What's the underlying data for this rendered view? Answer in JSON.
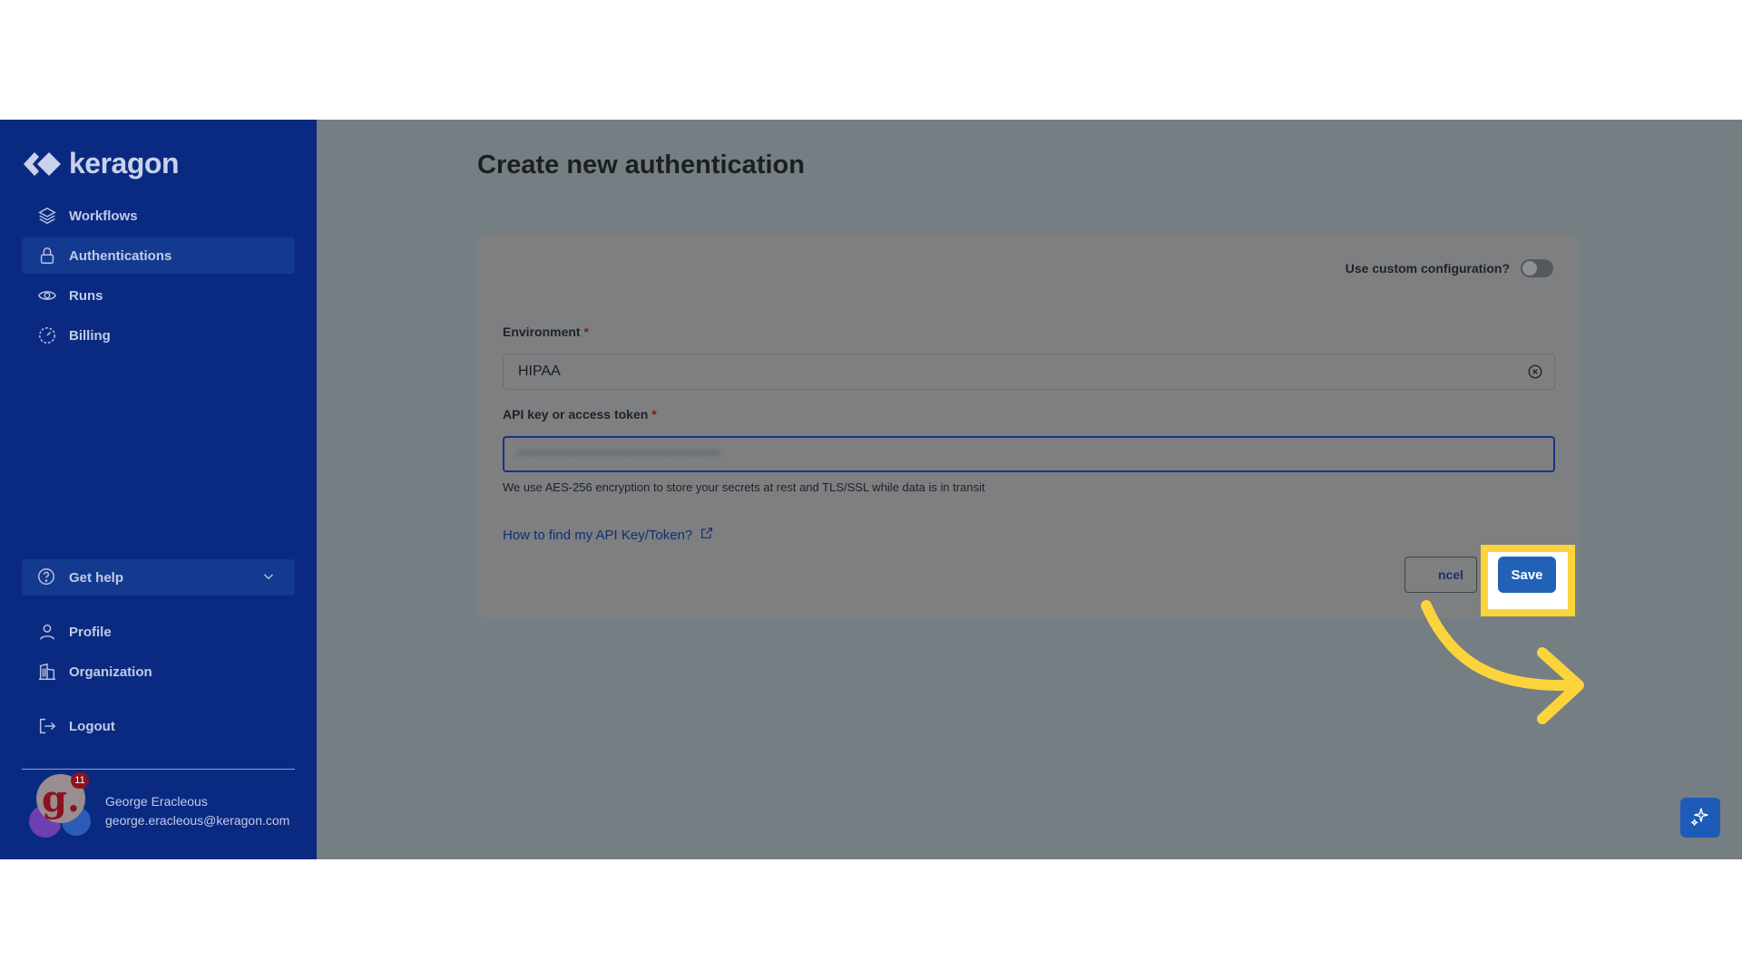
{
  "brand": {
    "name": "keragon"
  },
  "sidebar": {
    "items": [
      {
        "label": "Workflows",
        "icon": "layers-icon"
      },
      {
        "label": "Authentications",
        "icon": "lock-icon",
        "active": true
      },
      {
        "label": "Runs",
        "icon": "eye-icon"
      },
      {
        "label": "Billing",
        "icon": "gauge-icon"
      }
    ],
    "help": {
      "label": "Get help",
      "icon": "help-circle-icon"
    },
    "bottom_items": [
      {
        "label": "Profile",
        "icon": "user-icon"
      },
      {
        "label": "Organization",
        "icon": "building-icon"
      },
      {
        "label": "Logout",
        "icon": "logout-icon"
      }
    ],
    "user": {
      "name": "George Eracleous",
      "email": "george.eracleous@keragon.com",
      "avatar_letter": "g.",
      "notification_count": "11"
    }
  },
  "main": {
    "title": "Create new authentication",
    "form": {
      "custom_config_label": "Use custom configuration?",
      "environment": {
        "label": "Environment",
        "required_mark": "*",
        "value": "HIPAA"
      },
      "token": {
        "label": "API key or access token",
        "required_mark": "*",
        "masked_value": "••••••••••••••••••••••••••••••••••"
      },
      "hint": "We use AES-256 encryption to store your secrets at rest and TLS/SSL while data is in transit",
      "help_link": "How to find my API Key/Token?",
      "cancel_label": "ncel",
      "save_label": "Save"
    }
  },
  "colors": {
    "sidebar_bg": "#0a2a82",
    "overlay_bg": "#757e83",
    "save_button": "#2262b6",
    "highlight": "#fbd43c"
  }
}
